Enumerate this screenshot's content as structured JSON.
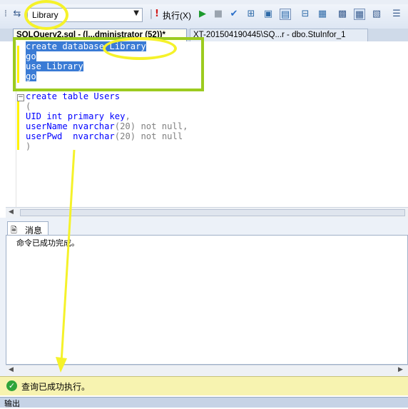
{
  "toolbar": {
    "database": "Library",
    "execute_label": "执行(X)"
  },
  "tabs": [
    {
      "label": "SQLQuery2.sql - (l...dministrator (52))*"
    },
    {
      "label": "XT-201504190445\\SQ...r - dbo.StuInfor_1"
    }
  ],
  "editor": {
    "lines_selected": [
      "create database Library",
      "go",
      "use Library",
      "go"
    ],
    "line_create_table": [
      "create",
      "table",
      "Users"
    ],
    "line_paren_open": "(",
    "line_uid": [
      "UID",
      "int",
      "primary",
      "key",
      ","
    ],
    "line_username": [
      "userName",
      "nvarchar",
      "(20)",
      "not null",
      ","
    ],
    "line_userpwd": [
      "userPwd",
      "nvarchar",
      "(20)",
      "not null"
    ],
    "line_paren_close": ")"
  },
  "results": {
    "tab_label": "消息",
    "message": "命令已成功完成。"
  },
  "status": {
    "text": "查询已成功执行。"
  },
  "output": {
    "label": "输出"
  },
  "colors": {
    "annotation_yellow": "#f5f22a",
    "annotation_green": "#9ccb1f",
    "selection": "#3a7bd5",
    "keyword": "#0000ff"
  }
}
